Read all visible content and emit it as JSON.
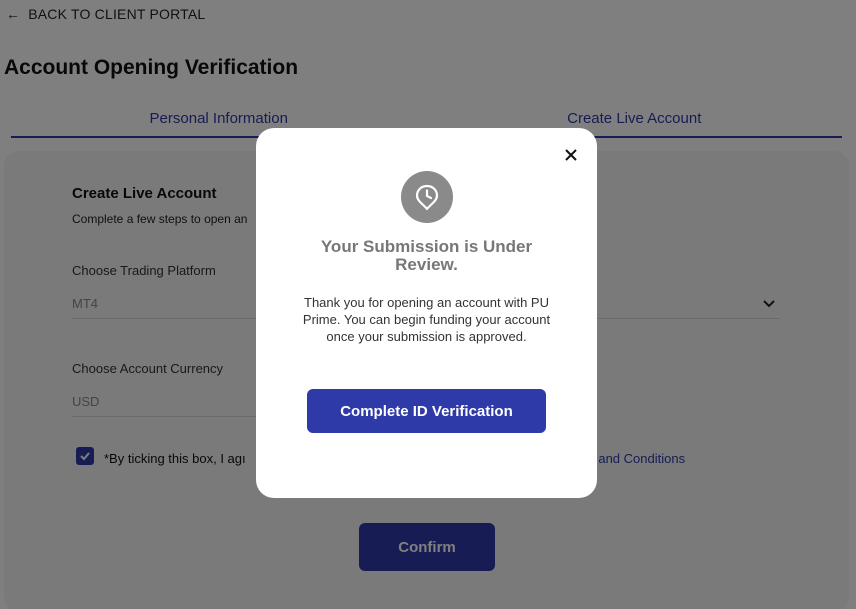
{
  "header": {
    "back_label": "BACK TO CLIENT PORTAL",
    "page_title": "Account Opening Verification"
  },
  "tabs": [
    {
      "label": "Personal Information"
    },
    {
      "label": "Create Live Account"
    }
  ],
  "form": {
    "section_title": "Create Live Account",
    "subtitle_visible_start": "Complete a few steps to open an",
    "subtitle_visible_end": ".",
    "platform_label": "Choose Trading Platform",
    "platform_value": "MT4",
    "currency_label": "Choose Account Currency",
    "currency_value": "USD",
    "consent_text_visible": "*By ticking this box, I agı",
    "consent_link_visible": "ns and Conditions",
    "checkbox_checked": true,
    "confirm_label": "Confirm"
  },
  "modal": {
    "title": "Your Submission is Under Review.",
    "body": "Thank you for opening an account with PU Prime. You can begin funding your account once your submission is approved.",
    "button_label": "Complete ID Verification",
    "icon": "clock-pin-icon",
    "close_icon": "close-icon"
  },
  "colors": {
    "accent": "#2e3aa8",
    "overlay": "rgba(0,0,0,0.5)",
    "modal_icon_bg": "#8a8a8a"
  }
}
